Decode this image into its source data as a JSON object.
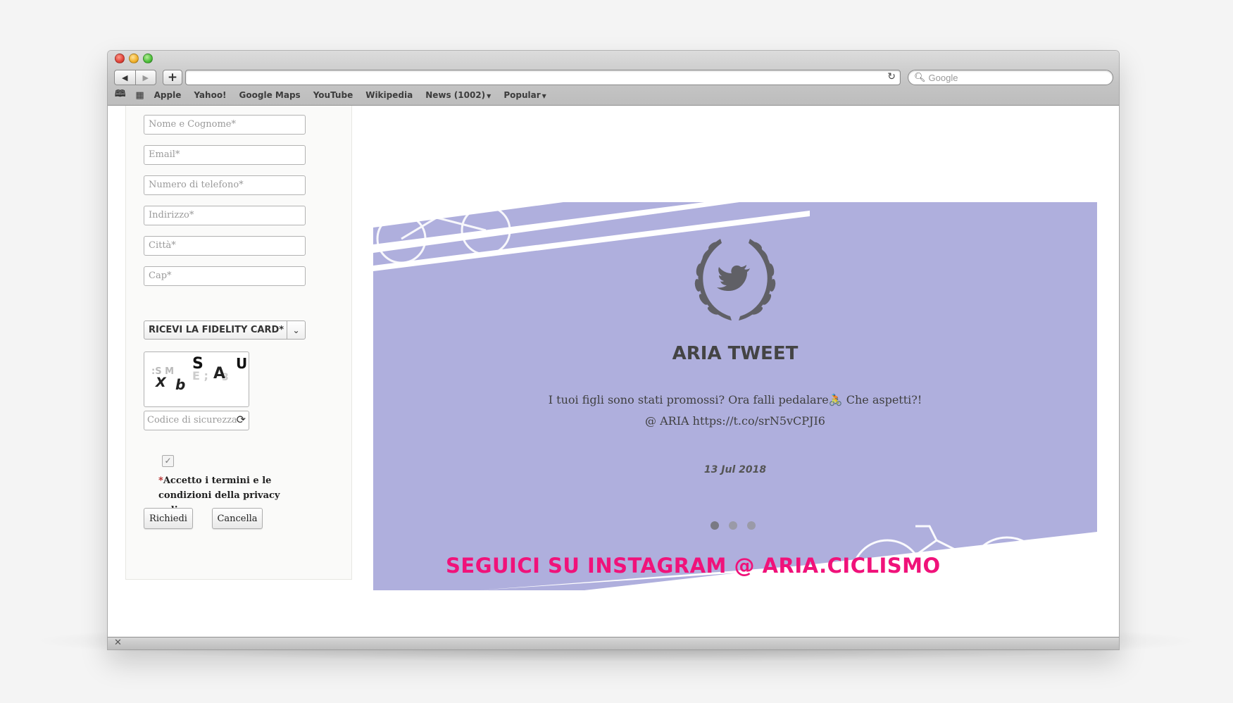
{
  "browser": {
    "search_placeholder": "Google",
    "bookmarks": [
      "Apple",
      "Yahoo!",
      "Google Maps",
      "YouTube",
      "Wikipedia",
      "News (1002)",
      "Popular"
    ]
  },
  "form": {
    "fields": [
      {
        "placeholder": "Nome e Cognome*"
      },
      {
        "placeholder": "Email*"
      },
      {
        "placeholder": "Numero di telefono*"
      },
      {
        "placeholder": "Indirizzo*"
      },
      {
        "placeholder": "Città*"
      },
      {
        "placeholder": "Cap*"
      }
    ],
    "fidelity_select": "RICEVI LA FIDELITY CARD*",
    "captcha_letters": "X b S A U",
    "code_placeholder": "Codice di sicurezza*",
    "terms_asterisk": "*",
    "terms_text": "Accetto i termini e le condizioni della privacy policy",
    "submit_label": "Richiedi",
    "cancel_label": "Cancella"
  },
  "tweet": {
    "title": "ARIA TWEET",
    "line1": "I tuoi figli sono stati promossi? Ora falli pedalare🚴 Che aspetti?!",
    "line2": "@ ARIA https://t.co/srN5vCPJI6",
    "date": "13 Jul 2018",
    "slides": 3,
    "active_slide": 1,
    "banner_color": "#afafdd"
  },
  "instagram": "SEGUICI SU INSTAGRAM @ ARIA.CICLISMO"
}
